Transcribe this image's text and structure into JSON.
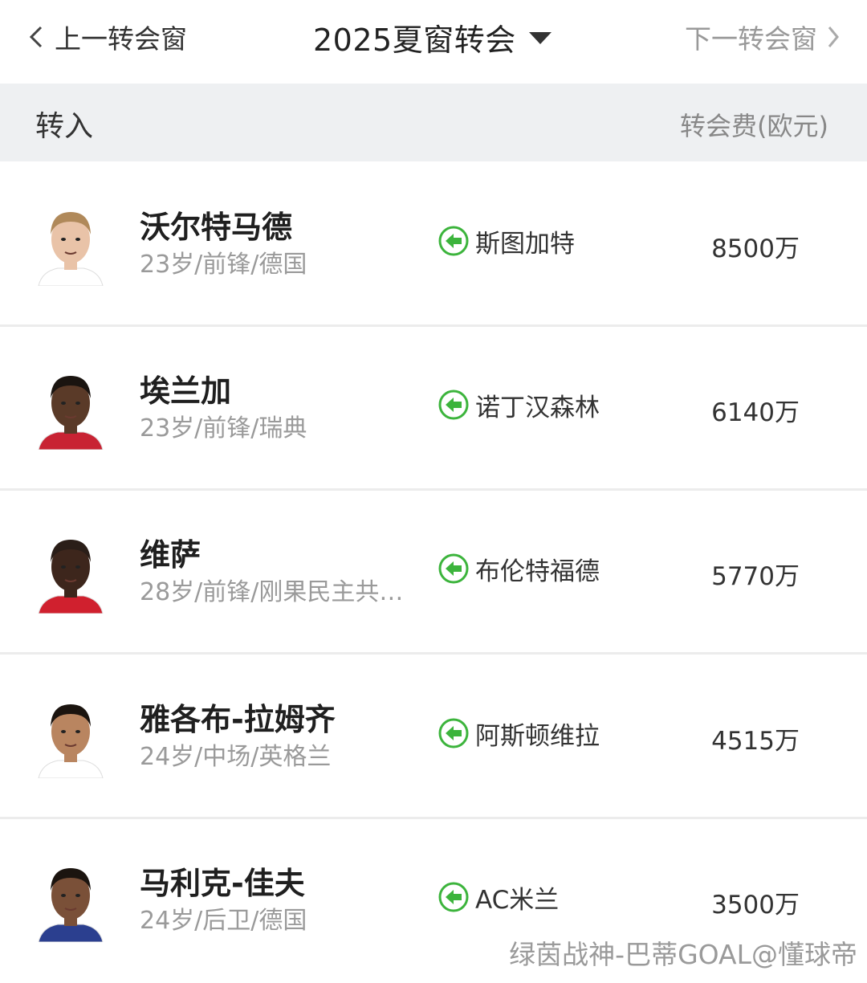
{
  "nav": {
    "prev_label": "上一转会窗",
    "title": "2025夏窗转会",
    "next_label": "下一转会窗"
  },
  "header": {
    "left": "转入",
    "right": "转会费(欧元)"
  },
  "transfers": [
    {
      "name": "沃尔特马德",
      "info": "23岁/前锋/德国",
      "club": "斯图加特",
      "fee": "8500万",
      "hair": "#b0895a",
      "skin": "#e9c3a8",
      "shirt": "#ffffff"
    },
    {
      "name": "埃兰加",
      "info": "23岁/前锋/瑞典",
      "club": "诺丁汉森林",
      "fee": "6140万",
      "hair": "#1a1410",
      "skin": "#5a3a28",
      "shirt": "#c82333"
    },
    {
      "name": "维萨",
      "info": "28岁/前锋/刚果民主共…",
      "club": "布伦特福德",
      "fee": "5770万",
      "hair": "#2a1e18",
      "skin": "#3d261c",
      "shirt": "#d0202e"
    },
    {
      "name": "雅各布-拉姆齐",
      "info": "24岁/中场/英格兰",
      "club": "阿斯顿维拉",
      "fee": "4515万",
      "hair": "#1b140f",
      "skin": "#b98560",
      "shirt": "#ffffff"
    },
    {
      "name": "马利克-佳夫",
      "info": "24岁/后卫/德国",
      "club": "AC米兰",
      "fee": "3500万",
      "hair": "#1b140f",
      "skin": "#7a5038",
      "shirt": "#2b3f8f"
    }
  ],
  "watermark": "绿茵战神-巴蒂GOAL@懂球帝",
  "colors": {
    "arrow_green": "#3cb43c",
    "header_bg": "#eef0f2"
  }
}
